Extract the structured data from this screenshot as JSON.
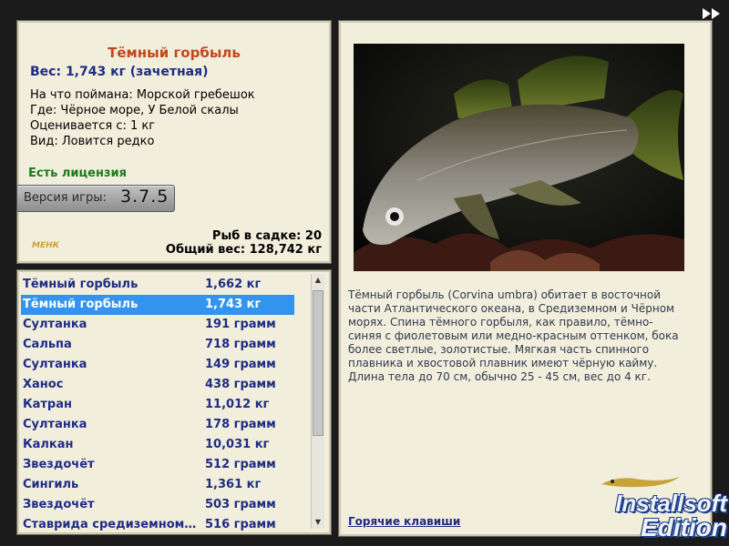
{
  "info": {
    "fish_name": "Тёмный горбыль",
    "weight_line": "Вес: 1,743 кг (зачетная)",
    "caught_on": "На что поймана: Морской гребешок",
    "location": "Где: Чёрное море, У Белой скалы",
    "rated_from": "Оценивается с: 1 кг",
    "species": "Вид: Ловится редко",
    "license": "Есть лицензия",
    "version_label": "Версия игры:",
    "version_number": "3.7.5",
    "small_logo": "МЕНК",
    "fish_in_keepnet": "Рыб в садке: 20",
    "total_weight": "Общий вес: 128,742 кг"
  },
  "catch_list": [
    {
      "name": "Тёмный горбыль",
      "weight": "1,662 кг",
      "selected": false
    },
    {
      "name": "Тёмный горбыль",
      "weight": "1,743 кг",
      "selected": true
    },
    {
      "name": "Султанка",
      "weight": "191 грамм",
      "selected": false
    },
    {
      "name": "Сальпа",
      "weight": "718 грамм",
      "selected": false
    },
    {
      "name": "Султанка",
      "weight": "149 грамм",
      "selected": false
    },
    {
      "name": "Ханос",
      "weight": "438 грамм",
      "selected": false
    },
    {
      "name": "Катран",
      "weight": "11,012 кг",
      "selected": false
    },
    {
      "name": "Султанка",
      "weight": "178 грамм",
      "selected": false
    },
    {
      "name": "Калкан",
      "weight": "10,031 кг",
      "selected": false
    },
    {
      "name": "Звездочёт",
      "weight": "512 грамм",
      "selected": false
    },
    {
      "name": "Сингиль",
      "weight": "1,361 кг",
      "selected": false
    },
    {
      "name": "Звездочёт",
      "weight": "503 грамм",
      "selected": false
    },
    {
      "name": "Ставрида средиземном…",
      "weight": "516 грамм",
      "selected": false
    }
  ],
  "right": {
    "description": "Тёмный горбыль (Corvina umbra) обитает в восточной части Атлантического океана, в Средиземном и Чёрном морях. Спина тёмного горбыля, как правило, тёмно-синяя с фиолетовым или медно-красным оттенком, бока более светлые, золотистые. Мягкая часть спинного плавника и хвостовой плавник имеют чёрную кайму. Длина тела до 70 см, обычно 25 - 45 см, вес до 4 кг.",
    "hotkeys": "Горячие клавиши"
  },
  "watermark": {
    "line1": "Installsoft",
    "line2": "Edition"
  },
  "colors": {
    "panel_bg": "#f2eedc",
    "accent_title": "#c3471d",
    "text_blue": "#1f2c86",
    "selected_row": "#3394ee",
    "license_green": "#1b7b1b"
  }
}
